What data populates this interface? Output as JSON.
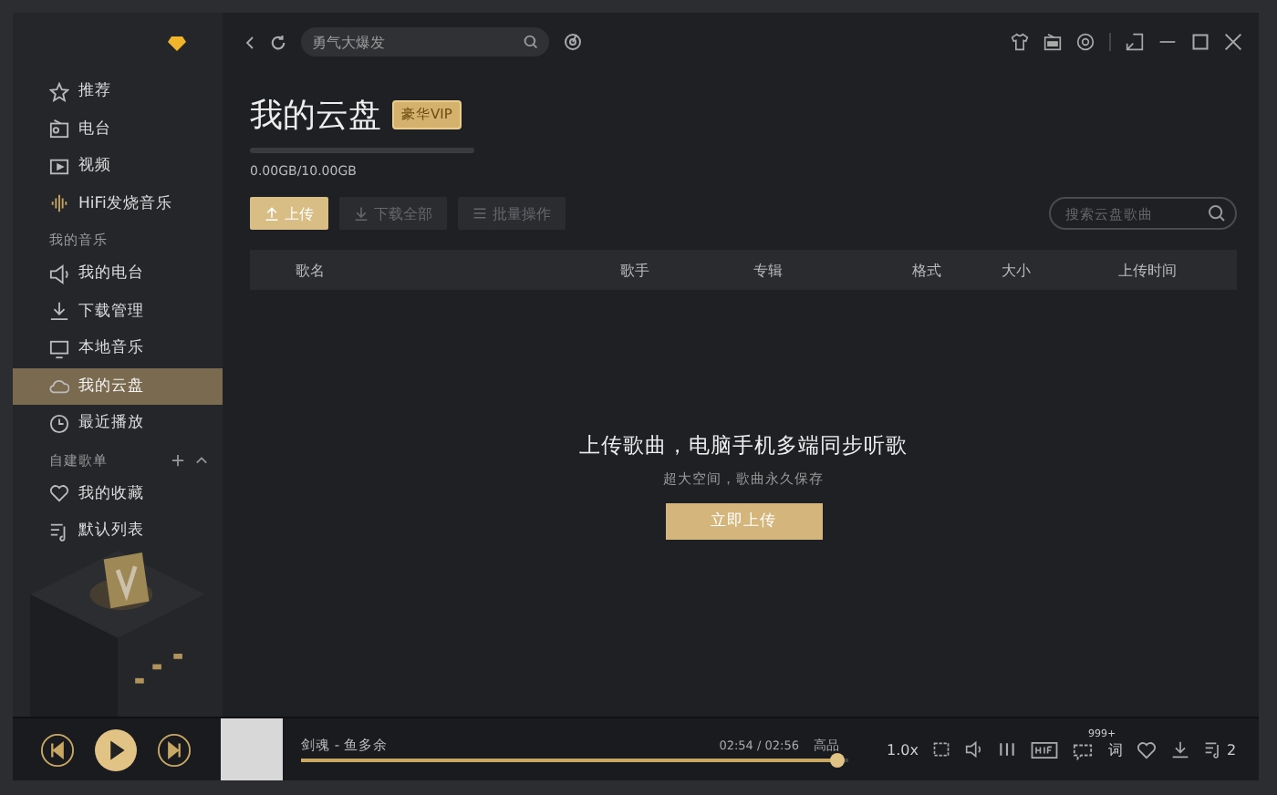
{
  "sidebar": {
    "groups": [
      {
        "items": [
          {
            "label": "推荐",
            "kind": "star",
            "selected": false
          },
          {
            "label": "电台",
            "kind": "radio",
            "selected": false
          },
          {
            "label": "视频",
            "kind": "video",
            "selected": false
          },
          {
            "label": "HiFi发烧音乐",
            "kind": "wave",
            "selected": false
          }
        ]
      },
      {
        "title": "我的音乐",
        "items": [
          {
            "label": "我的电台",
            "kind": "speaker",
            "selected": false
          },
          {
            "label": "下载管理",
            "kind": "download",
            "selected": false
          },
          {
            "label": "本地音乐",
            "kind": "monitor",
            "selected": false
          },
          {
            "label": "我的云盘",
            "kind": "cloud",
            "selected": true
          },
          {
            "label": "最近播放",
            "kind": "clock",
            "selected": false
          }
        ]
      },
      {
        "title": "自建歌单",
        "tools": true,
        "items": [
          {
            "label": "我的收藏",
            "kind": "heart",
            "selected": false
          },
          {
            "label": "默认列表",
            "kind": "list",
            "selected": false
          }
        ]
      }
    ]
  },
  "topbar": {
    "search": {
      "value": "勇气大爆发"
    }
  },
  "page": {
    "title": "我的云盘",
    "badge": "豪华VIP",
    "storage": {
      "text": "0.00GB/10.00GB"
    },
    "actions": [
      {
        "label": "上传",
        "kind": "upload",
        "disabled": false
      },
      {
        "label": "下载全部",
        "kind": "download",
        "disabled": true
      },
      {
        "label": "批量操作",
        "kind": "batch",
        "disabled": true
      }
    ],
    "search": {
      "placeholder": "搜索云盘歌曲"
    },
    "columns": [
      "歌名",
      "歌手",
      "专辑",
      "格式",
      "大小",
      "上传时间"
    ],
    "empty": {
      "title": "上传歌曲，电脑手机多端同步听歌",
      "subtitle": "超大空间，歌曲永久保存",
      "button": "立即上传"
    }
  },
  "player": {
    "song": "剑魂 - 鱼多余",
    "time": "02:54 / 02:56",
    "quality": "高品",
    "progress": {
      "level": 0.98
    },
    "speed": "1.0x",
    "comments": "999+",
    "lyrics": "词",
    "playlist_count": "2"
  }
}
